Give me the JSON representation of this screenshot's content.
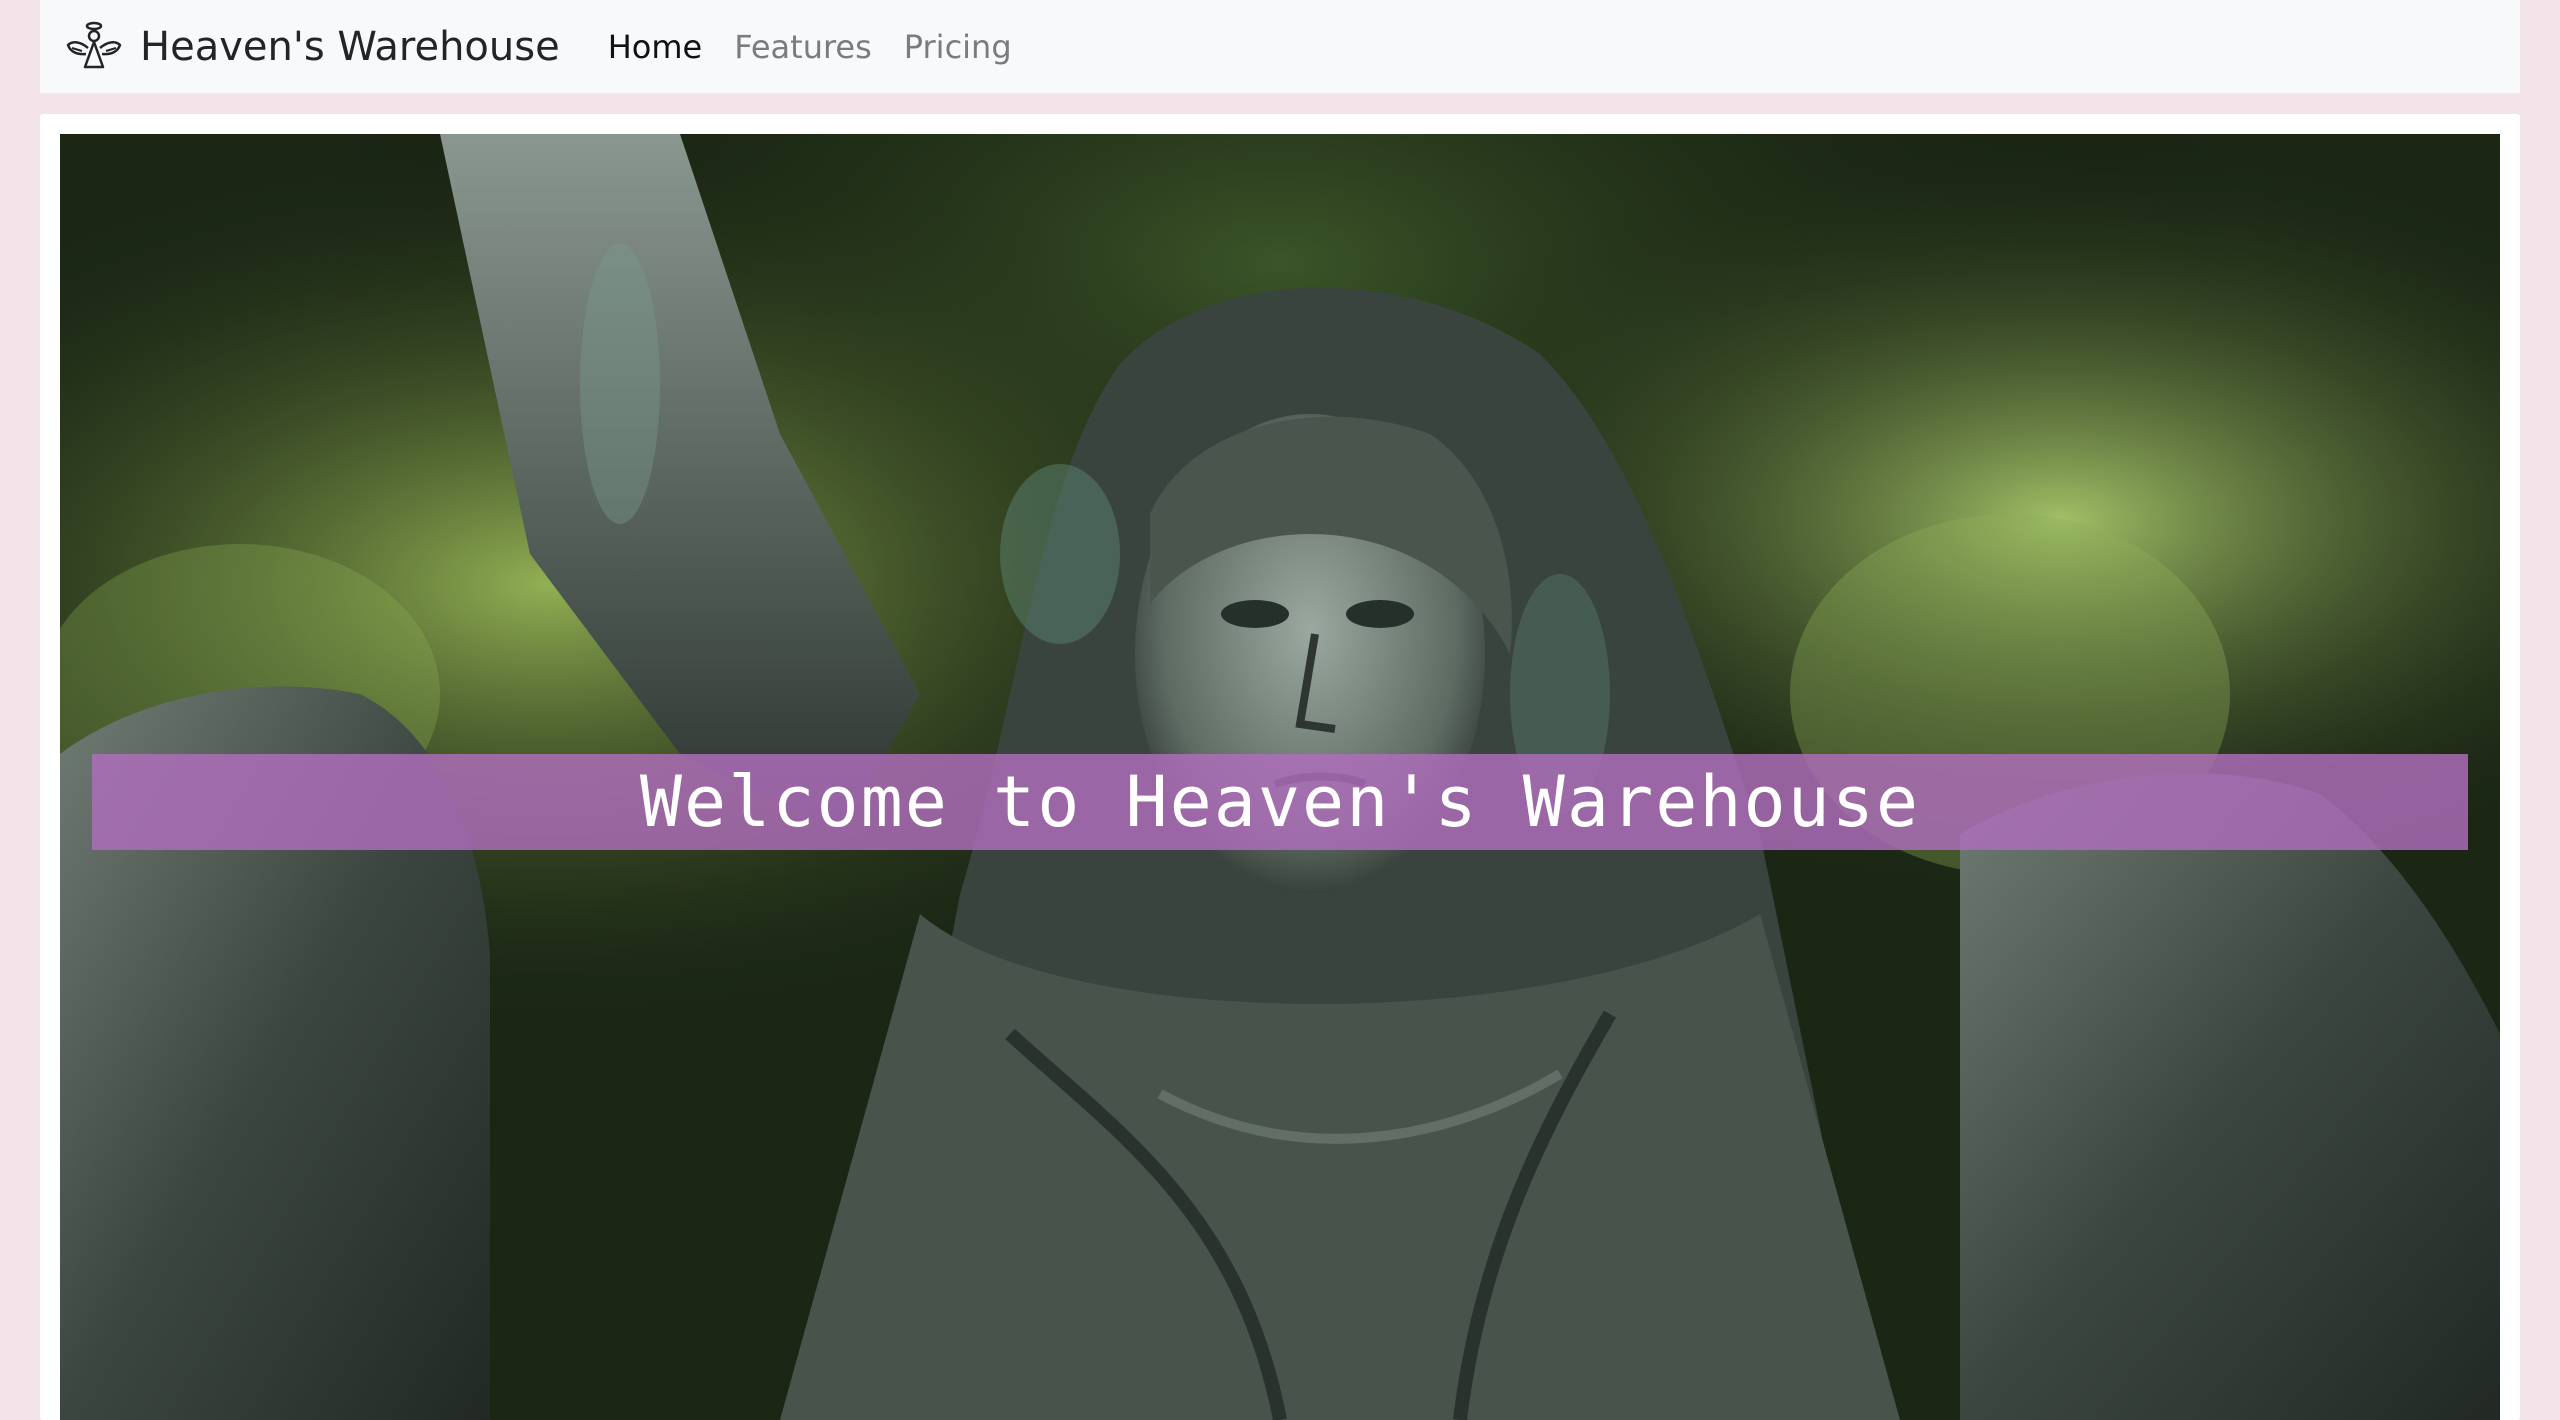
{
  "navbar": {
    "brand": {
      "icon": "angel-icon",
      "label": "Heaven's Warehouse"
    },
    "links": [
      {
        "label": "Home",
        "active": true
      },
      {
        "label": "Features",
        "active": false
      },
      {
        "label": "Pricing",
        "active": false
      }
    ]
  },
  "hero": {
    "image": "angel-statue-photo",
    "banner_text": "Welcome to Heaven's Warehouse",
    "banner_color": "#b06ebc"
  },
  "colors": {
    "page_background": "#f3e4ea",
    "navbar_background": "#f8f9fa",
    "nav_active": "#111111",
    "nav_inactive": "#7a7d80"
  }
}
